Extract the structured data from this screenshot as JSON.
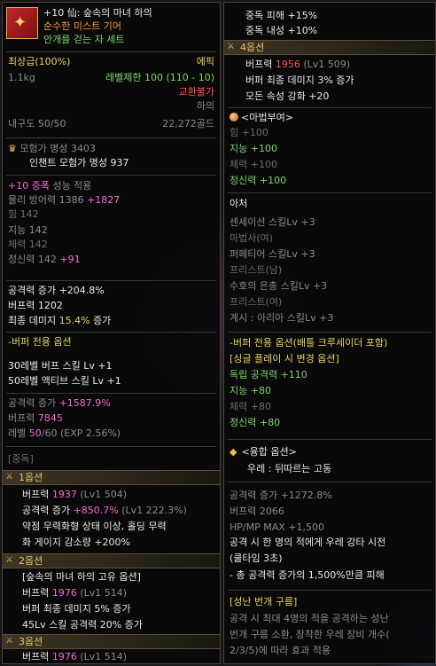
{
  "left": {
    "title_line1": "+10 仙: 숲속의 마녀 하의",
    "title_line2": "순수한 미스트 기어",
    "title_line3": "안개를 걷는 자 세트",
    "grade": "최상급(100%)",
    "rarity": "에픽",
    "weight": "1.1kg",
    "level_limit": "레벨제한 100 (110 - 10)",
    "trade": "교환불가",
    "slot": "하의",
    "durability": "내구도 50/50",
    "price": "22,272골드",
    "fame_label": "모험가 명성 3403",
    "enchant_fame": "인챈트 모험가 명성 937",
    "amp_prefix": "+10 증폭",
    "amp_suffix": " 성능 적용",
    "phys_def": "물리 방어력 1386 ",
    "phys_def_bonus": "+1827",
    "str": "힘 142",
    "int": "지능 142",
    "vit": "체력 142",
    "spr": "정신력 142 ",
    "spr_bonus": "+91",
    "atk_inc": "공격력 증가 +204.8%",
    "buff_power": "버프력 1202",
    "final_dmg_prefix": "최종 데미지 ",
    "final_dmg_val": "15.4%",
    "final_dmg_suffix": " 증가",
    "buffer_opt_title": "-버퍼 전용 옵션",
    "skill30": "30레벨 버프 스킬 Lv +1",
    "skill50": "50레벨 액티브 스킬 Lv +1",
    "atk_inc2_prefix": "공격력 증가 ",
    "atk_inc2_val": "+1587.9%",
    "buff_power2_prefix": "버프력 ",
    "buff_power2_val": "7845",
    "level_prefix": "레벨 ",
    "level_val": "50",
    "level_suffix": "/60 (EXP 2.56%)",
    "growth_label": "[중독]",
    "opt1_title": "1옵션",
    "opt1_line1_prefix": "버프력 ",
    "opt1_line1_val": "1937",
    "opt1_line1_suffix": " (Lv1 504)",
    "opt1_line2_prefix": "공격력 증가 ",
    "opt1_line2_val": "+850.7%",
    "opt1_line2_suffix": " (Lv1 222.3%)",
    "opt1_line3": "약점 무력화형 상태 이상, 홀딩 무력",
    "opt1_line4": "화 게이지 감소량 +200%",
    "opt2_title": "2옵션",
    "opt2_line1": "[숲속의 마녀 하의 고유 옵션]",
    "opt2_line2_prefix": "버프력 ",
    "opt2_line2_val": "1976",
    "opt2_line2_suffix": " (Lv1 514)",
    "opt2_line3": "버퍼 최종 데미지 5% 증가",
    "opt2_line4": "45Lv 스킬 공격력 20% 증가",
    "opt3_title": "3옵션",
    "opt3_line1_prefix": "버프력 ",
    "opt3_line1_val": "1976",
    "opt3_line1_suffix": " (Lv1 514)"
  },
  "right": {
    "top1": "중독 피해 +15%",
    "top2": "중독 내성 +10%",
    "opt4_title": "4옵션",
    "opt4_line1_prefix": "버프력 ",
    "opt4_line1_val": "1956",
    "opt4_line1_suffix": " (Lv1 509)",
    "opt4_line2": "버퍼 최종 데미지 3% 증가",
    "opt4_line3": "모든 속성 강화 +20",
    "magic_title": "<마법부여>",
    "m_str": "힘 +100",
    "m_int": "지능 +100",
    "m_vit": "체력 +100",
    "m_spr": "정신력 +100",
    "class_title": "아처",
    "c1": "센세이션 스킬Lv +3",
    "c2": "마법사(여)",
    "c3": "퍼페티어 스킬Lv +3",
    "c4": "프리스트(남)",
    "c5": "수호의 은총 스킬Lv +3",
    "c6": "프리스트(여)",
    "c7": "계시 : 아리아 스킬Lv +3",
    "bufopt_title": "-버퍼 전용 옵션(배틀 크루세이더 포함)",
    "bufopt_sub": "[싱글 플레이 시 변경 옵션]",
    "b1": "독립 공격력 +110",
    "b2": "지능 +80",
    "b3": "체력 +80",
    "b4": "정신력 +80",
    "fusion_title": "<융합 옵션>",
    "fusion_name": "우레 : 뒤따르는 고동",
    "f1": "공격력 증가 +1272.8%",
    "f2": "버프력 2066",
    "f3": "HP/MP MAX +1,500",
    "f4": "공격 시 한 명의 적에게 우레 강타 시전",
    "f5": "(쿨타임 3초)",
    "f6": "- 총 공격력 증가의 1,500%만큼 피해",
    "cloud_title": "[성난 번개 구름]",
    "cl1": "공격 시 최대 4명의 적을 공격하는 성난",
    "cl2": "번개 구름 소환, 장착한 우레 장비 개수(",
    "cl3": "2/3/5)에 따라 효과 적용"
  },
  "icons": {
    "item": "item-icon",
    "fame": "fame-icon",
    "option_bar": "option-bar-icon",
    "enchant": "orb-icon",
    "fusion": "diamond-icon"
  }
}
